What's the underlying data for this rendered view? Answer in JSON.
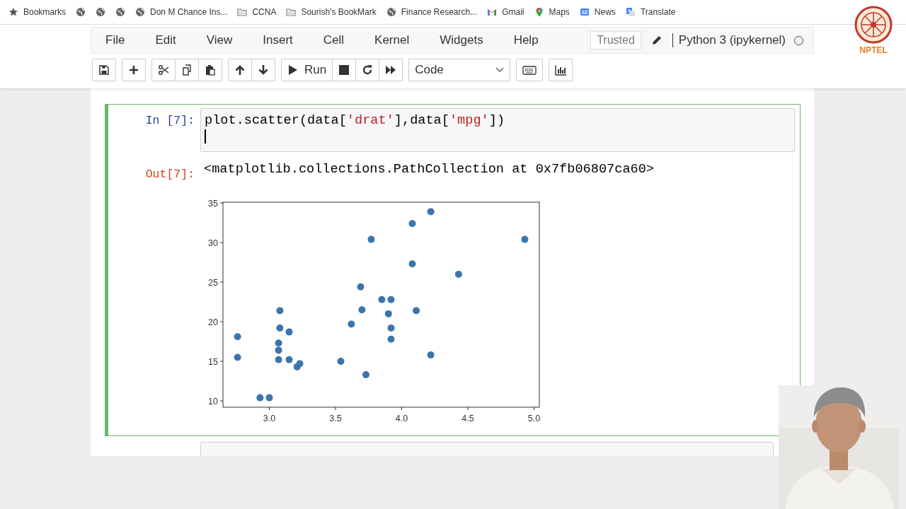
{
  "bookmarks": [
    {
      "kind": "star",
      "label": "Bookmarks"
    },
    {
      "kind": "globe"
    },
    {
      "kind": "globe"
    },
    {
      "kind": "globe"
    },
    {
      "kind": "globe",
      "label": "Don M Chance Ins..."
    },
    {
      "kind": "folder",
      "label": "CCNA"
    },
    {
      "kind": "folder",
      "label": "Sourish's BookMark"
    },
    {
      "kind": "globe",
      "label": "Finance Research..."
    },
    {
      "kind": "mail",
      "label": "Gmail"
    },
    {
      "kind": "pin",
      "label": "Maps"
    },
    {
      "kind": "news",
      "label": "News"
    },
    {
      "kind": "translate",
      "label": "Translate"
    }
  ],
  "menu": [
    "File",
    "Edit",
    "View",
    "Insert",
    "Cell",
    "Kernel",
    "Widgets",
    "Help"
  ],
  "trusted": "Trusted",
  "kernel": {
    "name": "Python 3 (ipykernel)",
    "busy": false
  },
  "toolbar": [
    [
      {
        "kind": "save"
      }
    ],
    [
      {
        "kind": "plus"
      }
    ],
    [
      {
        "kind": "cut"
      },
      {
        "kind": "copy"
      },
      {
        "kind": "paste"
      }
    ],
    [
      {
        "kind": "up"
      },
      {
        "kind": "down"
      }
    ],
    [
      {
        "kind": "run",
        "label": "Run"
      },
      {
        "kind": "stop"
      },
      {
        "kind": "restart"
      },
      {
        "kind": "fastforward"
      }
    ],
    [
      {
        "kind": "select",
        "label": "Code"
      }
    ],
    [
      {
        "kind": "keyboard"
      }
    ],
    [
      {
        "kind": "chart"
      }
    ]
  ],
  "cell": {
    "selected": true,
    "in_prompt": "In [7]:",
    "code": [
      {
        "kind": "plain",
        "text": "plot.scatter(data["
      },
      {
        "kind": "string",
        "text": "'drat'"
      },
      {
        "kind": "plain",
        "text": "],data["
      },
      {
        "kind": "string",
        "text": "'mpg'"
      },
      {
        "kind": "plain",
        "text": "])"
      }
    ],
    "out_prompt": "Out[7]:",
    "output": "<matplotlib.collections.PathCollection at 0x7fb06807ca60>",
    "chart_data": {
      "type": "scatter",
      "xlim": [
        2.65,
        5.04
      ],
      "ylim": [
        9.2,
        35.1
      ],
      "xticks": [
        {
          "value": 3,
          "label": "3.0"
        },
        {
          "value": 3.5,
          "label": "3.5"
        },
        {
          "value": 4,
          "label": "4.0"
        },
        {
          "value": 4.5,
          "label": "4.5"
        },
        {
          "value": 5,
          "label": "5.0"
        }
      ],
      "yticks": [
        10,
        15,
        20,
        25,
        30,
        35
      ],
      "series": [
        {
          "color": "#3a75ad",
          "x": [
            3.9,
            null,
            3.85,
            3.08,
            3.15,
            2.76,
            3.21,
            3.69,
            3.92,
            3.92,
            3.92,
            3.07,
            3.07,
            3.07,
            2.93,
            3.0,
            3.23,
            4.08,
            4.93,
            4.22,
            3.7,
            2.76,
            3.15,
            3.73,
            3.08,
            4.08,
            4.43,
            3.77,
            4.22,
            3.62,
            3.54,
            4.11
          ],
          "values": [
            21.0,
            null,
            22.8,
            21.4,
            18.7,
            18.1,
            14.3,
            24.4,
            22.8,
            19.2,
            17.8,
            16.4,
            17.3,
            15.2,
            10.4,
            10.4,
            14.7,
            32.4,
            30.4,
            33.9,
            21.5,
            15.5,
            15.2,
            13.3,
            19.2,
            27.3,
            26.0,
            30.4,
            15.8,
            19.7,
            15.0,
            21.4
          ]
        }
      ]
    }
  },
  "logo": {
    "text": "NPTEL"
  },
  "video": {
    "kind": "picture"
  }
}
